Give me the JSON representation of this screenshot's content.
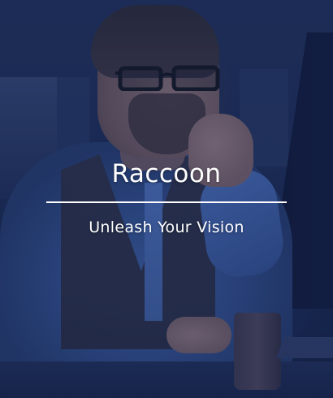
{
  "hero": {
    "title": "Raccoon",
    "tagline": "Unleash Your Vision"
  },
  "colors": {
    "overlay_tint": "#1c306e",
    "text": "#ffffff",
    "background": "#15223f"
  }
}
